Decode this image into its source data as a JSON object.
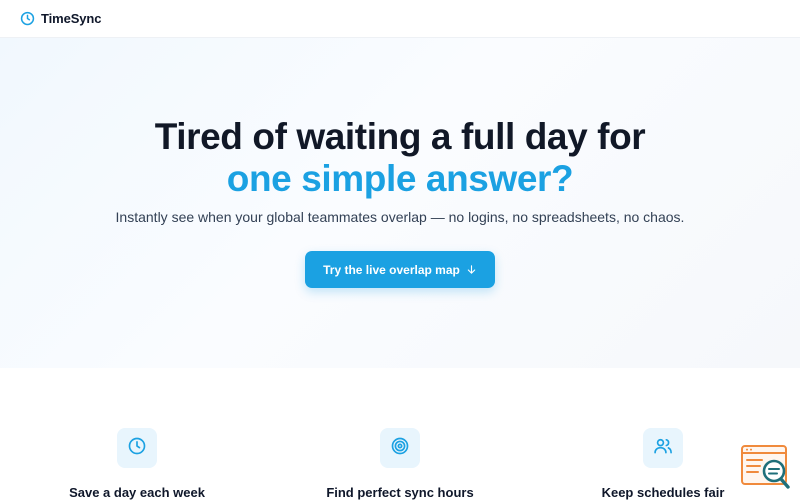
{
  "header": {
    "logo_text": "TimeSync",
    "logo_icon": "clock-icon"
  },
  "hero": {
    "title_line1": "Tired of waiting a full day for",
    "title_line2": "one simple answer?",
    "subtitle": "Instantly see when your global teammates overlap — no logins, no spreadsheets, no chaos.",
    "cta_label": "Try the live overlap map",
    "cta_icon": "arrow-down-icon"
  },
  "features": [
    {
      "title": "Save a day each week",
      "icon": "clock-icon"
    },
    {
      "title": "Find perfect sync hours",
      "icon": "target-icon"
    },
    {
      "title": "Keep schedules fair",
      "icon": "users-icon"
    }
  ],
  "colors": {
    "accent": "#1ba1e2",
    "heading": "#111827",
    "icon_bg": "#e8f5fd",
    "widget_orange": "#f08a3c",
    "widget_teal": "#1f6f7a"
  }
}
